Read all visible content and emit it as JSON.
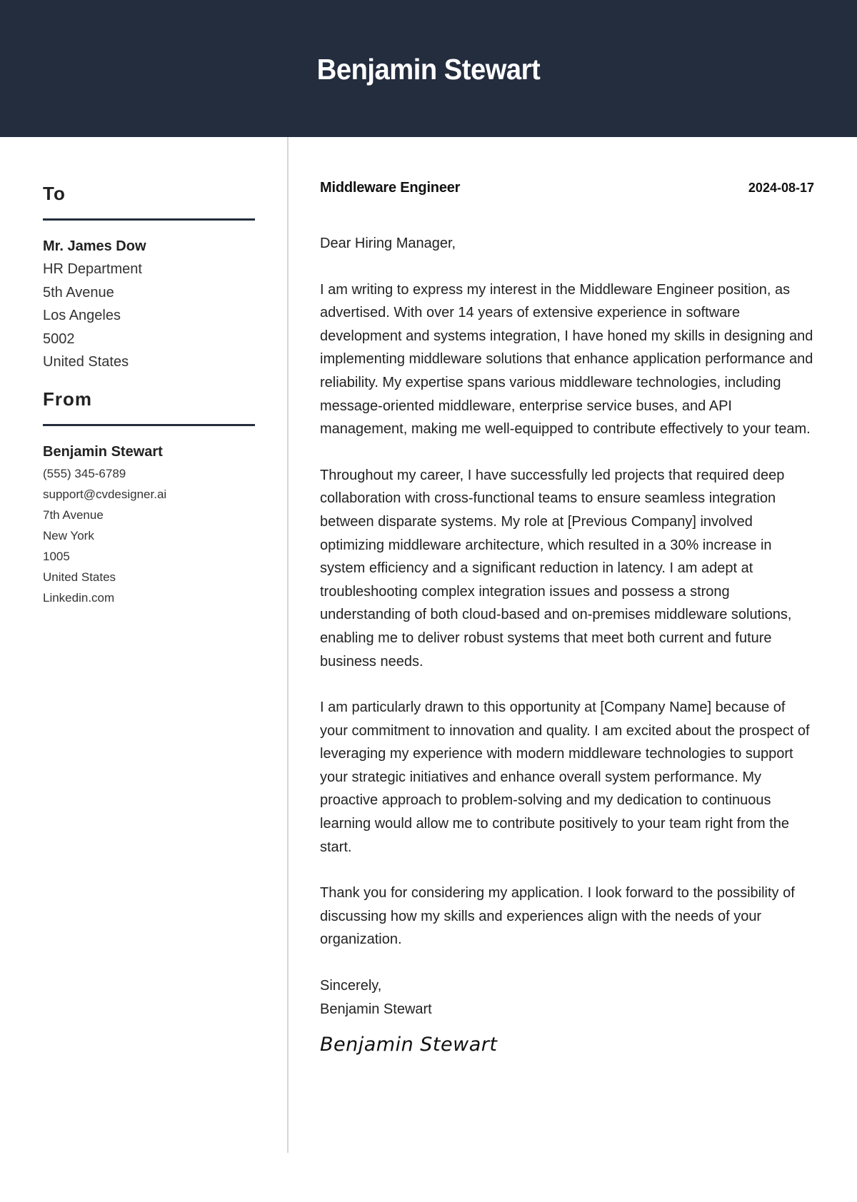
{
  "header": {
    "name": "Benjamin Stewart"
  },
  "colors": {
    "header_bg": "#242d3e",
    "rule": "#242d3e",
    "divider": "#d6d6d6"
  },
  "sidebar": {
    "to": {
      "title": "To",
      "name": "Mr. James Dow",
      "lines": [
        "HR Department",
        "5th Avenue",
        "Los Angeles",
        "5002",
        "United States"
      ]
    },
    "from": {
      "title": "From",
      "name": "Benjamin Stewart",
      "lines": [
        "(555) 345-6789",
        "support@cvdesigner.ai",
        "7th Avenue",
        "New York",
        "1005",
        "United States",
        "Linkedin.com"
      ]
    }
  },
  "letter": {
    "job_title": "Middleware Engineer",
    "date": "2024-08-17",
    "greeting": "Dear Hiring Manager,",
    "paragraphs": [
      "I am writing to express my interest in the Middleware Engineer position, as advertised. With over 14 years of extensive experience in software development and systems integration, I have honed my skills in designing and implementing middleware solutions that enhance application performance and reliability. My expertise spans various middleware technologies, including message-oriented middleware, enterprise service buses, and API management, making me well-equipped to contribute effectively to your team.",
      "Throughout my career, I have successfully led projects that required deep collaboration with cross-functional teams to ensure seamless integration between disparate systems. My role at [Previous Company] involved optimizing middleware architecture, which resulted in a 30% increase in system efficiency and a significant reduction in latency. I am adept at troubleshooting complex integration issues and possess a strong understanding of both cloud-based and on-premises middleware solutions, enabling me to deliver robust systems that meet both current and future business needs.",
      "I am particularly drawn to this opportunity at [Company Name] because of your commitment to innovation and quality. I am excited about the prospect of leveraging my experience with modern middleware technologies to support your strategic initiatives and enhance overall system performance. My proactive approach to problem-solving and my dedication to continuous learning would allow me to contribute positively to your team right from the start.",
      "Thank you for considering my application. I look forward to the possibility of discussing how my skills and experiences align with the needs of your organization."
    ],
    "closing": "Sincerely,",
    "closing_name": "Benjamin Stewart",
    "signature": "Benjamin Stewart"
  }
}
